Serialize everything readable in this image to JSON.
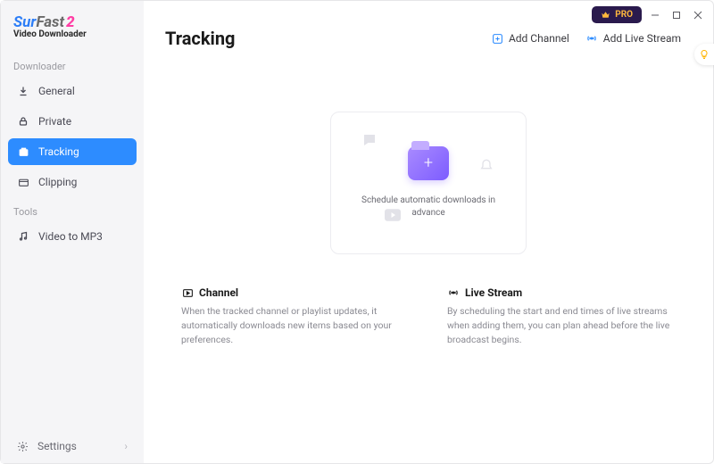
{
  "brand": {
    "line1a": "Sur",
    "line1b": "Fast",
    "line1c": "2",
    "line2": "Video Downloader"
  },
  "sidebar": {
    "section1": "Downloader",
    "items1": [
      {
        "label": "General"
      },
      {
        "label": "Private"
      },
      {
        "label": "Tracking"
      },
      {
        "label": "Clipping"
      }
    ],
    "section2": "Tools",
    "items2": [
      {
        "label": "Video to MP3"
      }
    ],
    "settingsLabel": "Settings"
  },
  "titlebar": {
    "proLabel": "PRO"
  },
  "header": {
    "title": "Tracking",
    "addChannel": "Add Channel",
    "addLive": "Add Live Stream"
  },
  "card": {
    "text": "Schedule automatic downloads in advance"
  },
  "info": {
    "channel": {
      "title": "Channel",
      "desc": "When the tracked channel or playlist updates, it automatically downloads new items based on your preferences."
    },
    "live": {
      "title": "Live Stream",
      "desc": "By scheduling the start and end times of live streams when adding them, you can plan ahead before the live broadcast begins."
    }
  }
}
